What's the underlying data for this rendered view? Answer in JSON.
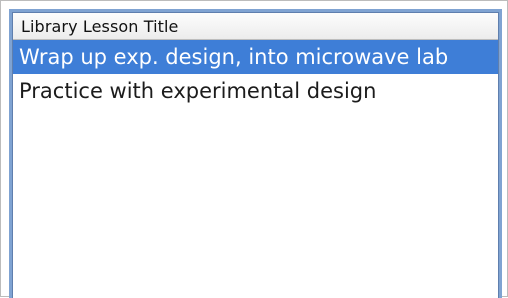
{
  "list": {
    "column_header": "Library Lesson Title",
    "rows": [
      {
        "title": "Wrap up exp. design, into microwave lab",
        "selected": true
      },
      {
        "title": "Practice with experimental design",
        "selected": false
      }
    ]
  },
  "colors": {
    "selection": "#3e7ed7",
    "focus_ring": "#7fa3d2"
  }
}
